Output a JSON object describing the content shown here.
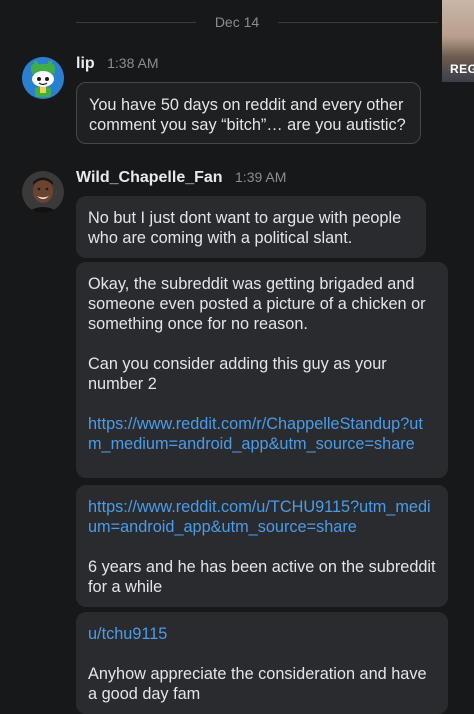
{
  "date_separator": "Dec 14",
  "corner_thumbnail": {
    "label": "REG"
  },
  "messages": [
    {
      "author": "lip",
      "time": "1:38 AM",
      "avatar_icon": "robot-snoo-avatar-icon",
      "bubbles": [
        {
          "paragraphs": [
            "You have 50 days on reddit and every other comment you say “bitch”… are you autistic?"
          ]
        }
      ]
    },
    {
      "author": "Wild_Chapelle_Fan",
      "time": "1:39 AM",
      "avatar_icon": "profile-photo-avatar-icon",
      "bubbles": [
        {
          "paragraphs": [
            "No but I just dont want to argue with people who are coming with a political slant."
          ]
        },
        {
          "paragraphs": [
            "Okay, the subreddit was getting brigaded and someone even posted a picture of a chicken or something once for no reason.",
            "Can you consider adding this guy as your number 2"
          ],
          "link": "https://www.reddit.com/r/ChappelleStandup?utm_medium=android_app&utm_source=share"
        },
        {
          "link": "https://www.reddit.com/u/TCHU9115?utm_medium=android_app&utm_source=share",
          "paragraphs": [
            "6 years and he has been active on the subreddit for a while"
          ]
        },
        {
          "link": "u/tchu9115",
          "paragraphs": [
            "Anyhow appreciate the consideration and have a good day fam"
          ]
        }
      ]
    }
  ],
  "colors": {
    "background": "#17181a",
    "bubble": "#2a2b2e",
    "link": "#4a9ce8",
    "text": "#e3e5e8",
    "muted": "#8a8d91"
  }
}
